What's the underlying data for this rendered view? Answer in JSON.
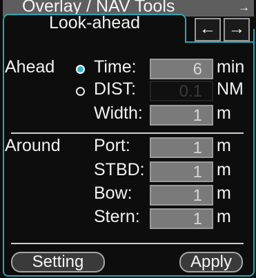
{
  "window": {
    "title": "Overlay / NAV Tools",
    "pin_glyph": "→"
  },
  "tab": {
    "label": "Look-ahead"
  },
  "nav": {
    "prev_glyph": "←",
    "next_glyph": "→"
  },
  "ahead": {
    "section_label": "Ahead",
    "selected_mode": "Time",
    "time": {
      "label": "Time:",
      "value": "6",
      "unit": "min"
    },
    "dist": {
      "label": "DIST:",
      "value": "0.1",
      "unit": "NM"
    },
    "width": {
      "label": "Width:",
      "value": "1",
      "unit": "m"
    }
  },
  "around": {
    "section_label": "Around",
    "port": {
      "label": "Port:",
      "value": "1",
      "unit": "m"
    },
    "stbd": {
      "label": "STBD:",
      "value": "1",
      "unit": "m"
    },
    "bow": {
      "label": "Bow:",
      "value": "1",
      "unit": "m"
    },
    "stern": {
      "label": "Stern:",
      "value": "1",
      "unit": "m"
    }
  },
  "buttons": {
    "setting": "Setting",
    "apply": "Apply"
  },
  "colors": {
    "accent": "#2aa8b4",
    "radio_selected": "#35b7c9",
    "background": "#0d0d0d",
    "field": "#7a7a7a"
  }
}
